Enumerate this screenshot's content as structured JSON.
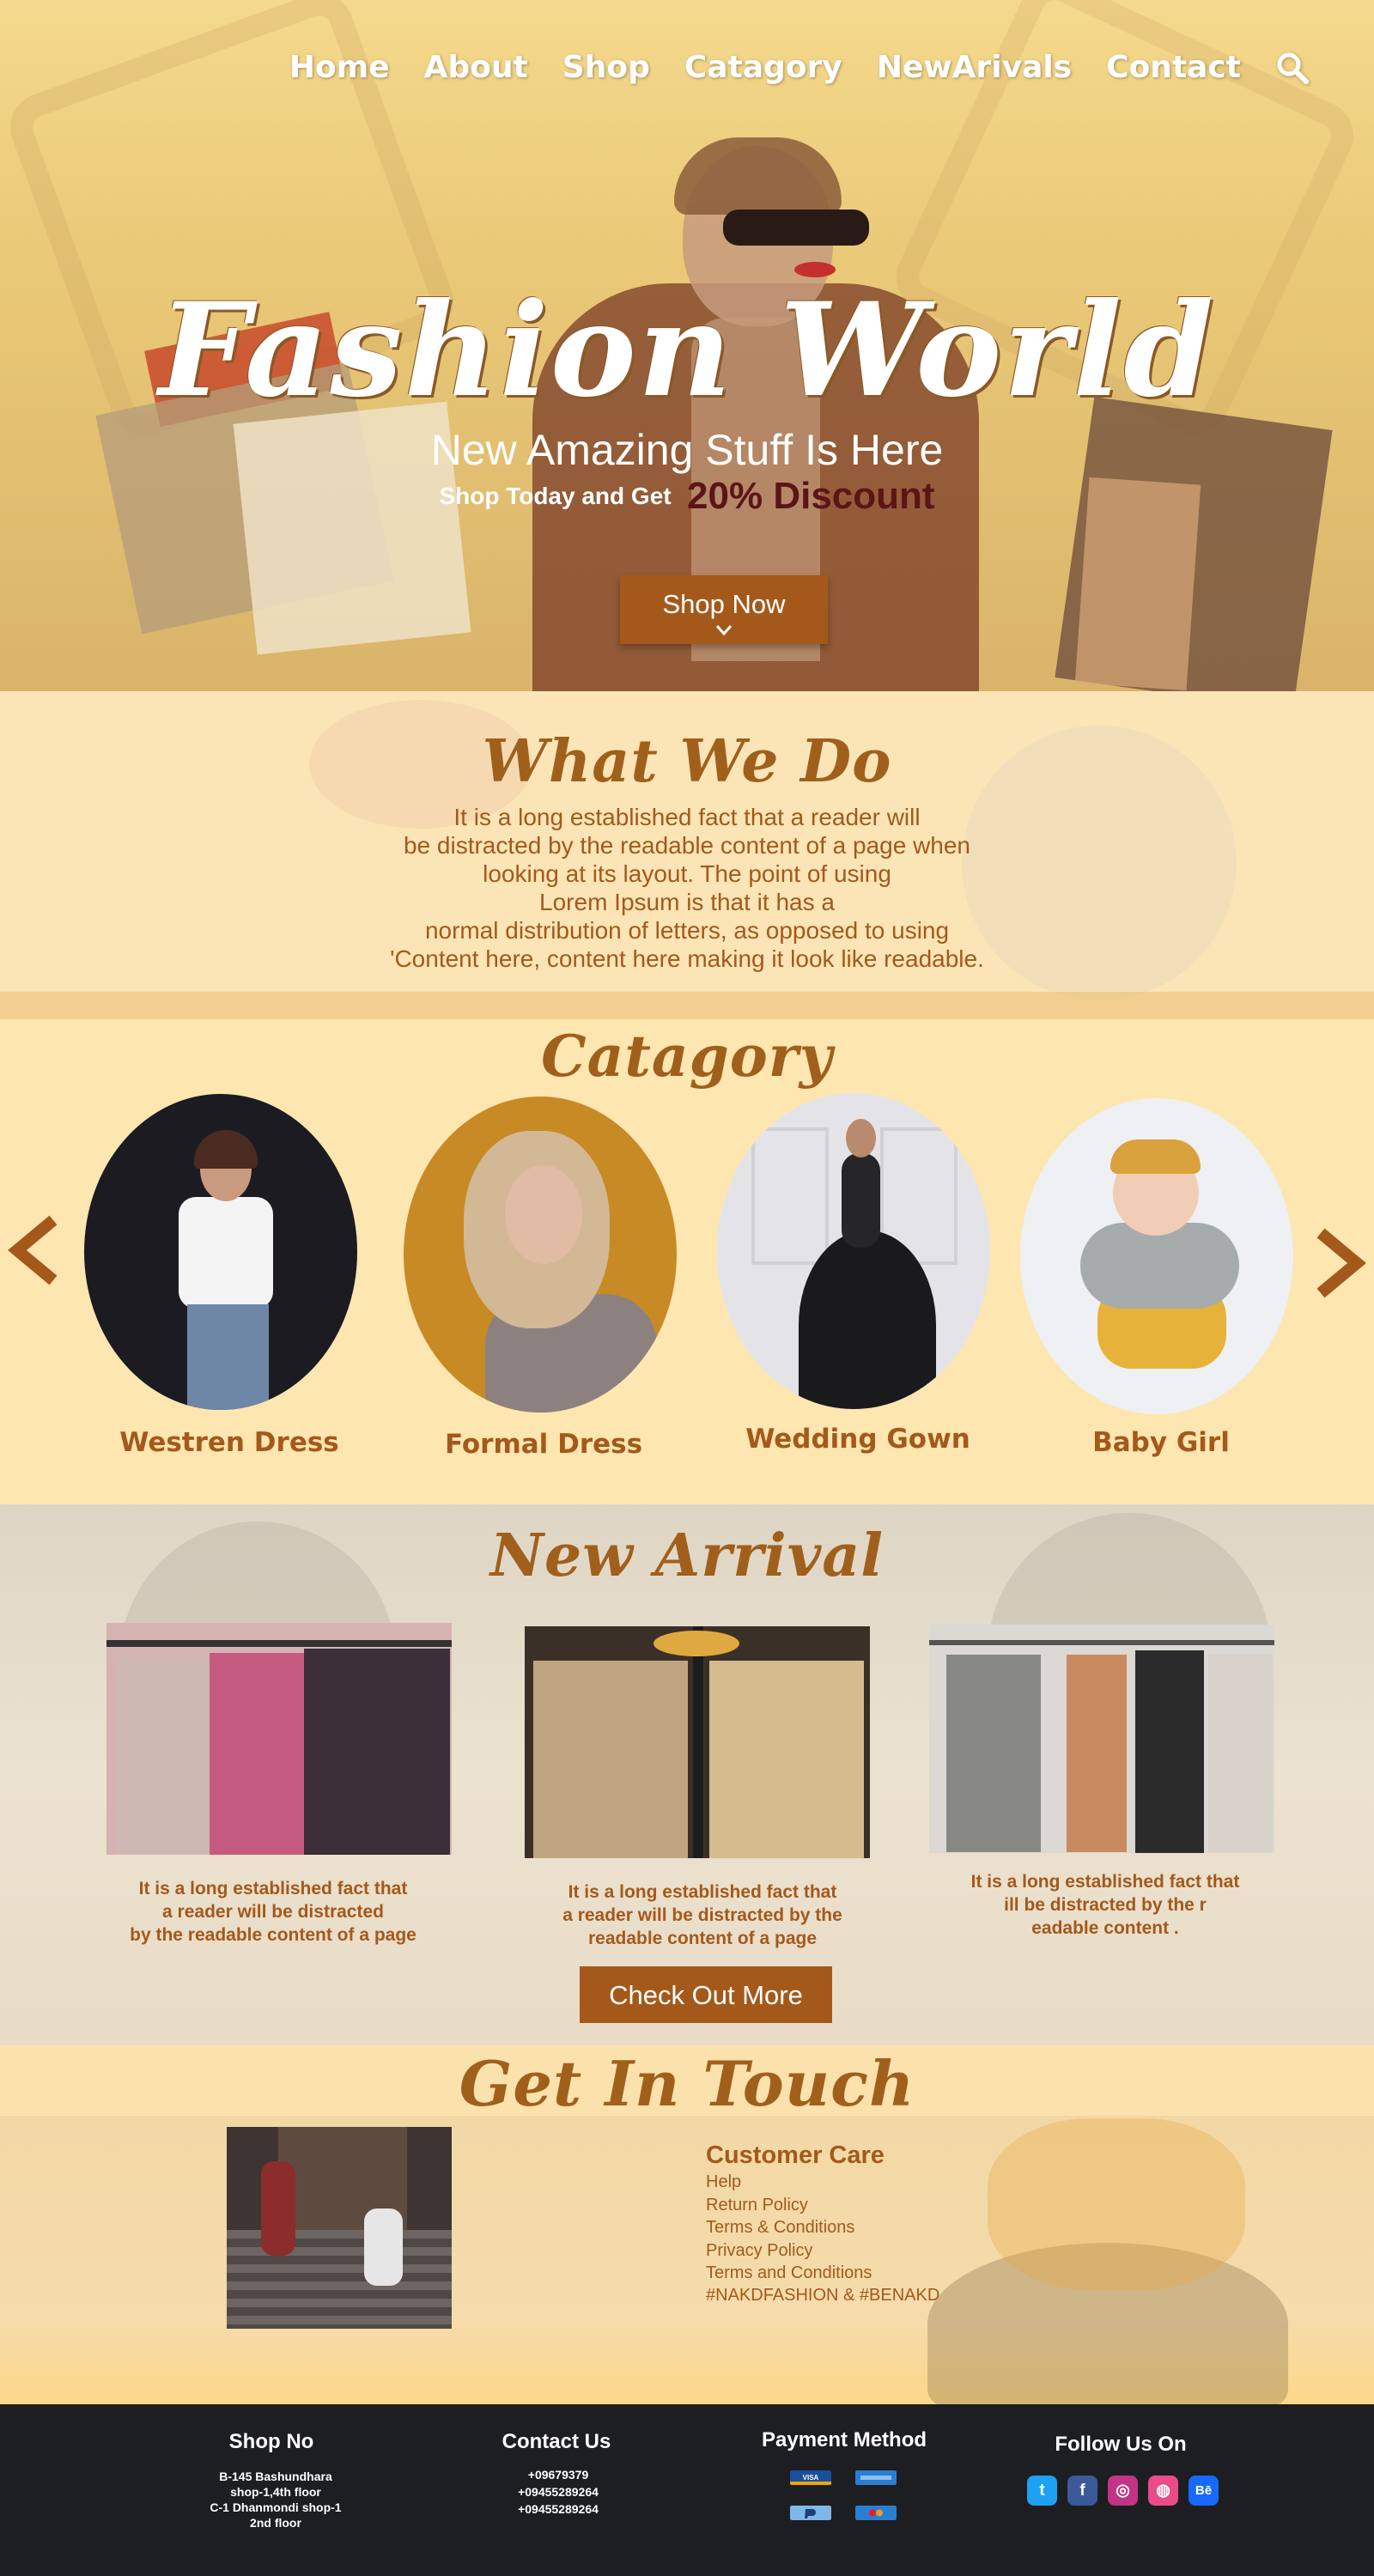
{
  "nav": {
    "items": [
      "Home",
      "About",
      "Shop",
      "Catagory",
      "NewArivals",
      "Contact"
    ],
    "search_icon": "search-icon"
  },
  "hero": {
    "title": "Fashion World",
    "subtitle": "New Amazing Stuff Is Here",
    "offer_text": "Shop Today and Get",
    "offer_discount": "20% Discount",
    "button_label": "Shop Now"
  },
  "what_we_do": {
    "title": "What We Do",
    "lines": [
      "It is a long established fact that a reader will",
      "be distracted by the readable content of a page when",
      "looking at its layout. The point of using",
      "Lorem Ipsum is that it has a",
      "normal distribution of letters, as opposed to using",
      "'Content here, content here making it look like readable."
    ]
  },
  "category": {
    "title": "Catagory",
    "items": [
      "Westren Dress",
      "Formal Dress",
      "Wedding Gown",
      "Baby Girl"
    ],
    "prev_icon": "chevron-left-icon",
    "next_icon": "chevron-right-icon"
  },
  "new_arrival": {
    "title": "New Arrival",
    "cards": [
      {
        "lines": [
          "It is a long established fact that",
          "a reader will be distracted",
          "by the readable content of a page"
        ]
      },
      {
        "lines": [
          "It is a long established fact that",
          "a reader will be distracted  by the",
          "readable content of a page"
        ]
      },
      {
        "lines": [
          "It is a long established fact that",
          "ill be distracted  by the r",
          "eadable content ."
        ]
      }
    ],
    "button_label": "Check Out More"
  },
  "get_in_touch": {
    "title": "Get In Touch",
    "customer_care_title": "Customer Care",
    "links": [
      "Help",
      "Return Policy",
      "Terms & Conditions",
      "Privacy Policy",
      "Terms and Conditions",
      "#NAKDFASHION & #BENAKD"
    ]
  },
  "footer": {
    "shop_title": "Shop No",
    "shop_lines": [
      "B-145 Bashundhara",
      "shop-1,4th floor",
      "C-1 Dhanmondi shop-1",
      "2nd floor"
    ],
    "contact_title": "Contact Us",
    "contact_lines": [
      "+09679379",
      "+09455289264",
      "+09455289264"
    ],
    "payment_title": "Payment Method",
    "payment_methods": [
      "VISA",
      "AMERICAN EXPRESS",
      "PayPal",
      "Maestro"
    ],
    "follow_title": "Follow  Us On",
    "social": [
      {
        "name": "twitter",
        "glyph": "t",
        "color": "#1da1f2"
      },
      {
        "name": "facebook",
        "glyph": "f",
        "color": "#3b5998"
      },
      {
        "name": "instagram",
        "glyph": "◎",
        "color": "#c13584"
      },
      {
        "name": "dribbble",
        "glyph": "◍",
        "color": "#ea4c89"
      },
      {
        "name": "behance",
        "glyph": "Bē",
        "color": "#1769ff"
      }
    ]
  },
  "colors": {
    "accent": "#a4591b",
    "discount": "#5b1518",
    "cream": "#fde6b0",
    "footer": "#1d1e21"
  }
}
